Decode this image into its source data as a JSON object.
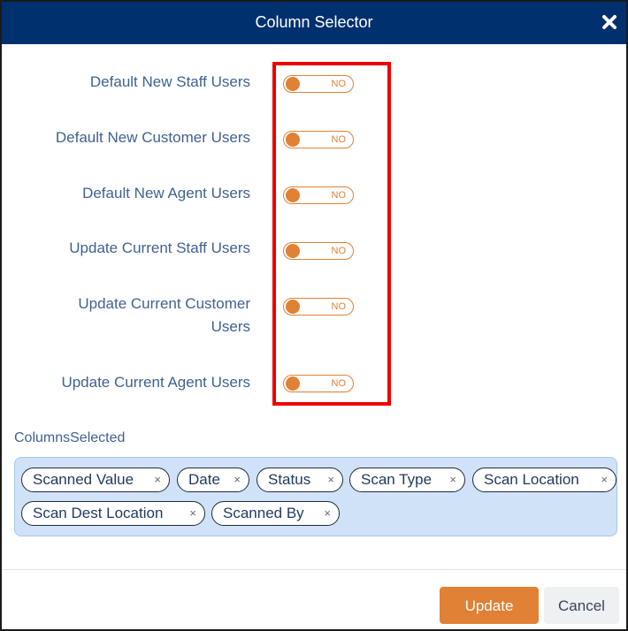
{
  "dialog": {
    "title": "Column Selector",
    "close_icon": "close-icon"
  },
  "toggles": [
    {
      "label": "Default New Staff Users",
      "state": "NO"
    },
    {
      "label": "Default New Customer Users",
      "state": "NO"
    },
    {
      "label": "Default New Agent Users",
      "state": "NO"
    },
    {
      "label": "Update Current Staff Users",
      "state": "NO"
    },
    {
      "label_line1": "Update Current Customer",
      "label_line2": "Users",
      "state": "NO"
    },
    {
      "label": "Update Current Agent Users",
      "state": "NO"
    }
  ],
  "columns": {
    "label": "ColumnsSelected",
    "chips": [
      {
        "label": "Scanned Value",
        "remove": "×"
      },
      {
        "label": "Date",
        "remove": "×"
      },
      {
        "label": "Status",
        "remove": "×"
      },
      {
        "label": "Scan Type",
        "remove": "×"
      },
      {
        "label": "Scan Location",
        "remove": "×"
      },
      {
        "label": "Scan Dest Location",
        "remove": "×"
      },
      {
        "label": "Scanned By",
        "remove": "×"
      }
    ]
  },
  "footer": {
    "update_label": "Update",
    "cancel_label": "Cancel"
  },
  "colors": {
    "header_bg": "#00306e",
    "accent_orange": "#e08135",
    "label_blue": "#3f6291",
    "highlight_red": "#ee0000",
    "chips_bg": "#cfe2f7"
  }
}
